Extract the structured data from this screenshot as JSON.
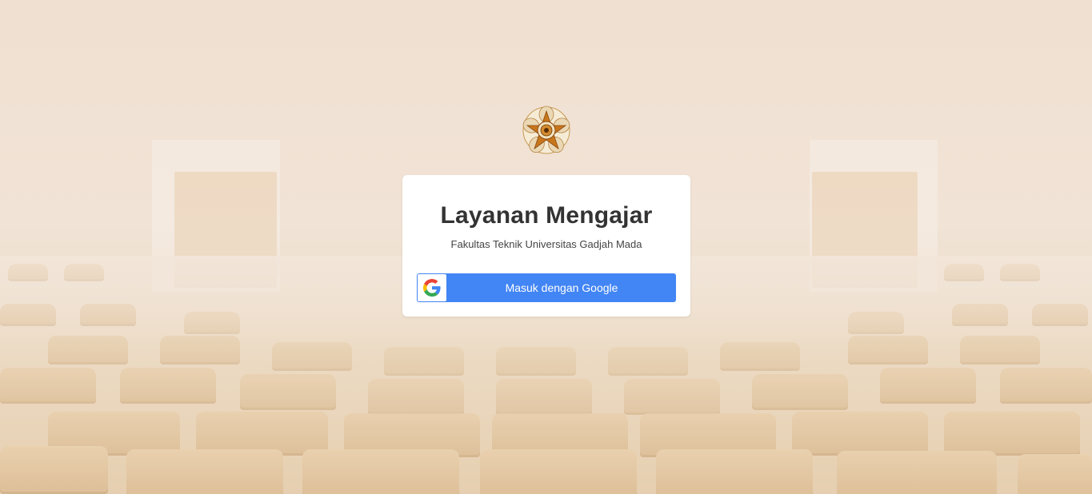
{
  "app": {
    "title": "Layanan Mengajar",
    "subtitle": "Fakultas Teknik Universitas Gadjah Mada"
  },
  "logo": {
    "icon": "ugm-seal-icon"
  },
  "login": {
    "google_button_label": "Masuk dengan Google",
    "google_icon": "google-g-icon"
  },
  "colors": {
    "google_blue": "#4285f4",
    "card_background": "#ffffff",
    "title_text": "#333333"
  }
}
